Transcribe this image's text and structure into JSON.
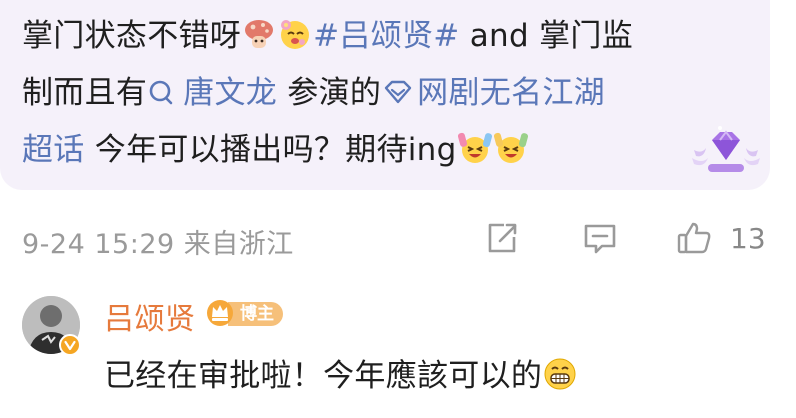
{
  "comment": {
    "line1_text": "掌门状态不错呀",
    "hashtag": "#吕颂贤#",
    "line1_suffix": " and 掌门监",
    "line2_prefix": "制而且有",
    "mention": "唐文龙",
    "line2_middle": " 参演的",
    "supertopic_line2": "网剧无名江湖",
    "supertopic_line3": "超话",
    "line3_suffix": " 今年可以播出吗？期待ing",
    "icons": {
      "emoji1": "mushroom-emoji",
      "emoji2": "flower-face-emoji",
      "mention_icon": "search-icon",
      "supertopic_icon": "diamond-icon",
      "emoji3": "cheering-emoji",
      "badge": "purple-gem-badge-icon"
    }
  },
  "meta": {
    "time_location": "9-24 15:29 来自浙江",
    "like_count": "13",
    "icons": [
      "share-icon",
      "comment-icon",
      "like-icon"
    ]
  },
  "reply": {
    "author": "吕颂贤",
    "badge_label": "博主",
    "text": "已经在审批啦！今年應該可以的",
    "icons": {
      "crown": "crown-icon",
      "verified": "verified-badge-icon",
      "emoji": "grinning-emoji"
    }
  },
  "colors": {
    "bubble_bg": "#f5f1fa",
    "link_blue": "#5a77b8",
    "meta_gray": "#9a9a9a",
    "author_orange": "#e67a3c",
    "badge_orange": "#f6c07a"
  }
}
